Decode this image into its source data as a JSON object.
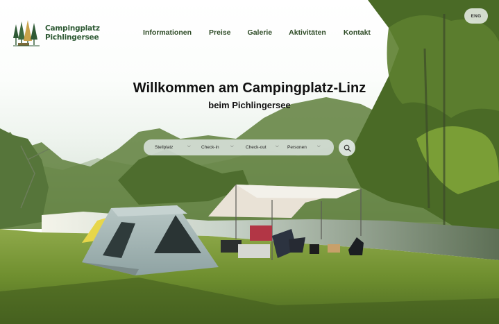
{
  "brand": {
    "line1": "Campingplatz",
    "line2": "Pichlingersee",
    "logo_icon": "pine-trees-logo-icon",
    "color": "#2f5a35"
  },
  "nav": {
    "items": [
      "Informationen",
      "Preise",
      "Galerie",
      "Aktivitäten",
      "Kontakt"
    ],
    "color": "#2e4b26"
  },
  "language": "ENG",
  "hero": {
    "title": "Willkommen am Campingplatz-Linz",
    "subtitle": "beim Pichlingersee"
  },
  "search": {
    "fields": [
      "Stellplatz",
      "Check-in",
      "Check-out",
      "Personen"
    ],
    "dropdown_icon": "chevron-down-icon",
    "button_icon": "search-icon"
  },
  "background": {
    "scene": "campsite-photo",
    "items": [
      "tent",
      "awning",
      "camping-table",
      "camping-chairs",
      "lake",
      "trees"
    ]
  }
}
